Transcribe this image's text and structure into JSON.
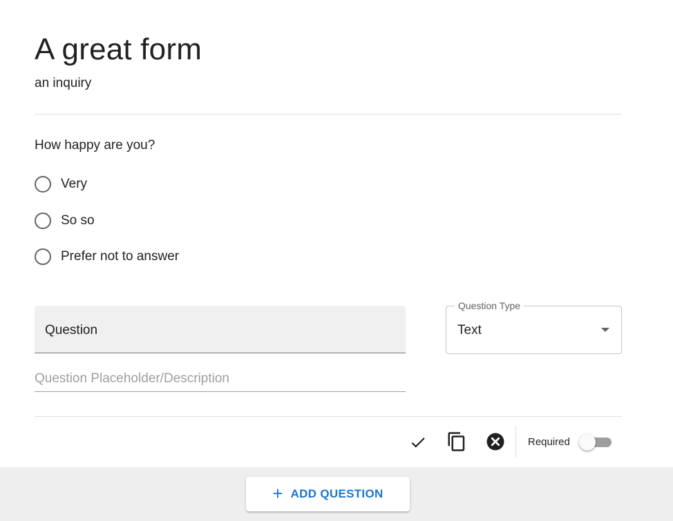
{
  "form": {
    "title": "A great form",
    "description": "an inquiry"
  },
  "question_preview": {
    "label": "How happy are you?",
    "options": [
      {
        "label": "Very"
      },
      {
        "label": "So so"
      },
      {
        "label": "Prefer not to answer"
      }
    ]
  },
  "editor": {
    "question_field": {
      "value": "Question"
    },
    "description_field": {
      "placeholder": "Question Placeholder/Description"
    },
    "question_type": {
      "label": "Question Type",
      "value": "Text"
    },
    "actions": {
      "confirm_icon": "check-icon",
      "duplicate_icon": "copy-icon",
      "delete_icon": "cancel-circle-icon"
    },
    "required": {
      "label": "Required",
      "on": false
    }
  },
  "footer": {
    "add_button_label": "ADD QUESTION"
  },
  "colors": {
    "accent": "#1976d2",
    "footer_bg": "#eeeeee",
    "filled_field_bg": "#f0f0f0"
  }
}
